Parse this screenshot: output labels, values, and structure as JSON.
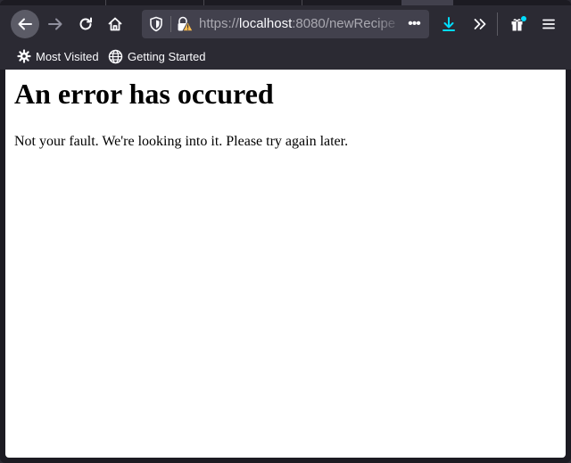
{
  "browser": {
    "url_prefix": "https://",
    "url_host": "localhost",
    "url_rest": ":8080/newRecipe",
    "more_label": "•••",
    "icons": {
      "back": "arrow-left-icon",
      "forward": "arrow-right-icon",
      "reload": "reload-icon",
      "home": "home-icon",
      "shield": "shield-icon",
      "lock": "lock-warning-icon",
      "download": "download-icon",
      "overflow": "chevron-double-right-icon",
      "gift": "gift-icon",
      "menu": "hamburger-menu-icon"
    },
    "colors": {
      "toolbar": "#2b2a33",
      "urlbar": "#42414d",
      "download_accent": "#0df",
      "warning": "#ffbd4f"
    }
  },
  "bookmarks": {
    "items": [
      {
        "label": "Most Visited",
        "icon": "gear-icon"
      },
      {
        "label": "Getting Started",
        "icon": "globe-icon"
      }
    ]
  },
  "page": {
    "title": "An error has occured",
    "message": "Not your fault. We're looking into it. Please try again later."
  }
}
